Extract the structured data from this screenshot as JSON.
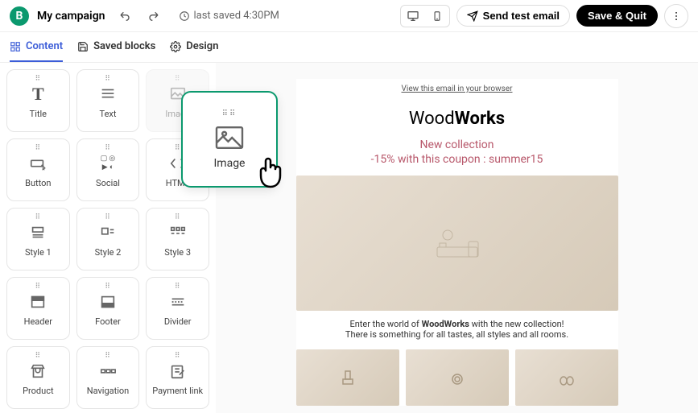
{
  "header": {
    "logo_letter": "B",
    "title": "My campaign",
    "last_saved": "last saved 4:30PM",
    "send_test": "Send test email",
    "save_quit": "Save & Quit"
  },
  "tabs": {
    "content": "Content",
    "saved": "Saved blocks",
    "design": "Design"
  },
  "blocks": [
    {
      "label": "Title",
      "icon": "title"
    },
    {
      "label": "Text",
      "icon": "text"
    },
    {
      "label": "Image",
      "icon": "image",
      "ghost": true
    },
    {
      "label": "Button",
      "icon": "button"
    },
    {
      "label": "Social",
      "icon": "social"
    },
    {
      "label": "HTML",
      "icon": "html"
    },
    {
      "label": "Style 1",
      "icon": "style1"
    },
    {
      "label": "Style 2",
      "icon": "style2"
    },
    {
      "label": "Style 3",
      "icon": "style3"
    },
    {
      "label": "Header",
      "icon": "header"
    },
    {
      "label": "Footer",
      "icon": "footer"
    },
    {
      "label": "Divider",
      "icon": "divider"
    },
    {
      "label": "Product",
      "icon": "product"
    },
    {
      "label": "Navigation",
      "icon": "navigation"
    },
    {
      "label": "Payment link",
      "icon": "payment"
    }
  ],
  "drag_block": {
    "label": "Image"
  },
  "email": {
    "browser_link": "View this email in your browser",
    "brand_light": "Wood",
    "brand_bold": "Works",
    "promo_line1": "New collection",
    "promo_line2": "-15% with this coupon : summer15",
    "desc_prefix": "Enter the world of ",
    "desc_brand": "WoodWorks",
    "desc_suffix": " with the new collection!",
    "desc_line2": "There is something for all tastes, all styles and all rooms."
  }
}
